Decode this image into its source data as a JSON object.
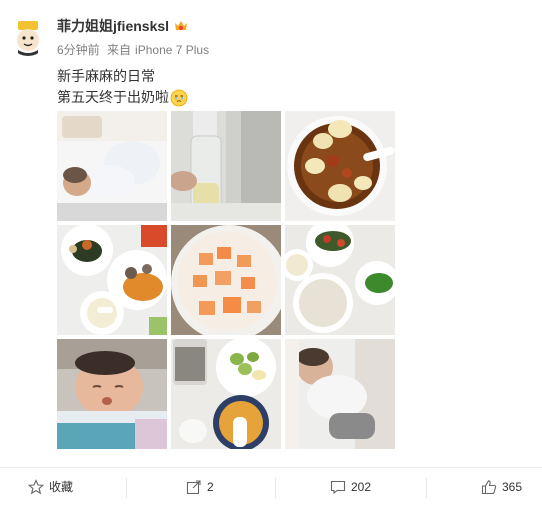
{
  "post": {
    "username": "菲力姐姐jfiensksl",
    "time": "6分钟前",
    "source_prefix": "来自",
    "source": "iPhone 7 Plus",
    "text_line1": "新手麻麻的日常",
    "text_line2": "第五天终于出奶啦"
  },
  "grid": {
    "images": [
      {
        "icon": "baby-in-bed-photo"
      },
      {
        "icon": "milk-bottle-photo"
      },
      {
        "icon": "soup-bowl-photo"
      },
      {
        "icon": "meal-plates-photo"
      },
      {
        "icon": "papaya-milk-photo"
      },
      {
        "icon": "porridge-meal-photo"
      },
      {
        "icon": "sleeping-baby-photo"
      },
      {
        "icon": "fruit-porridge-photo"
      },
      {
        "icon": "baby-in-crib-photo"
      }
    ]
  },
  "actions": {
    "favorite_label": "收藏",
    "repost_count": "2",
    "comment_count": "202",
    "like_count": "365"
  },
  "colors": {
    "text": "#333333",
    "meta": "#808080",
    "divider": "#ececec"
  }
}
